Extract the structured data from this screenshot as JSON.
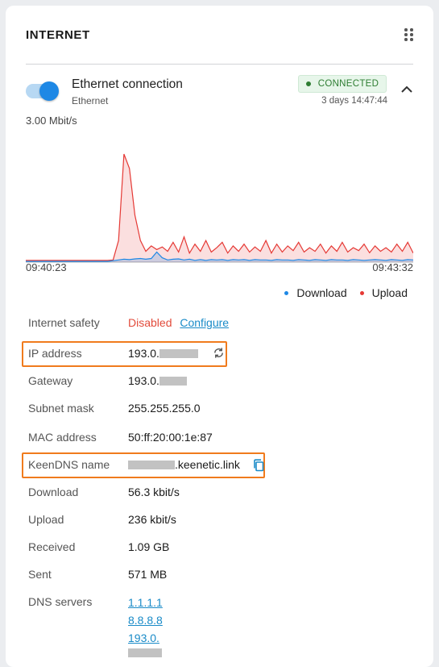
{
  "widget": {
    "title": "INTERNET"
  },
  "connection": {
    "name": "Ethernet connection",
    "subtitle": "Ethernet",
    "enabled": true,
    "status": "CONNECTED",
    "uptime": "3 days 14:47:44",
    "speed_label": "3.00 Mbit/s"
  },
  "chart_data": {
    "type": "area",
    "x_start": "09:40:23",
    "x_end": "09:43:32",
    "ylim": [
      0,
      3.0
    ],
    "y_unit": "Mbit/s",
    "series": [
      {
        "name": "Download",
        "color": "#1e88e5",
        "values": [
          0.02,
          0.02,
          0.02,
          0.02,
          0.02,
          0.02,
          0.02,
          0.02,
          0.02,
          0.02,
          0.02,
          0.02,
          0.02,
          0.02,
          0.02,
          0.02,
          0.04,
          0.06,
          0.08,
          0.07,
          0.09,
          0.1,
          0.08,
          0.1,
          0.28,
          0.12,
          0.06,
          0.08,
          0.09,
          0.06,
          0.08,
          0.05,
          0.07,
          0.05,
          0.07,
          0.06,
          0.07,
          0.05,
          0.07,
          0.06,
          0.07,
          0.05,
          0.07,
          0.06,
          0.06,
          0.05,
          0.07,
          0.06,
          0.06,
          0.05,
          0.07,
          0.06,
          0.05,
          0.07,
          0.06,
          0.05,
          0.07,
          0.06,
          0.06,
          0.05,
          0.07,
          0.06,
          0.05,
          0.06,
          0.07,
          0.06,
          0.05,
          0.07,
          0.06,
          0.05,
          0.07,
          0.06
        ]
      },
      {
        "name": "Upload",
        "color": "#e53935",
        "values": [
          0.05,
          0.05,
          0.05,
          0.05,
          0.05,
          0.05,
          0.05,
          0.05,
          0.05,
          0.05,
          0.05,
          0.05,
          0.05,
          0.05,
          0.05,
          0.05,
          0.06,
          0.6,
          3.0,
          2.6,
          1.3,
          0.6,
          0.3,
          0.45,
          0.35,
          0.42,
          0.3,
          0.55,
          0.28,
          0.7,
          0.25,
          0.5,
          0.3,
          0.6,
          0.28,
          0.4,
          0.55,
          0.25,
          0.45,
          0.3,
          0.5,
          0.28,
          0.42,
          0.3,
          0.6,
          0.25,
          0.5,
          0.28,
          0.45,
          0.32,
          0.55,
          0.28,
          0.4,
          0.3,
          0.5,
          0.25,
          0.45,
          0.3,
          0.55,
          0.28,
          0.4,
          0.32,
          0.5,
          0.26,
          0.45,
          0.3,
          0.4,
          0.28,
          0.5,
          0.3,
          0.55,
          0.25
        ]
      }
    ]
  },
  "legend": {
    "download": "Download",
    "upload": "Upload",
    "download_color": "#1e88e5",
    "upload_color": "#e53935"
  },
  "details": {
    "internet_safety_label": "Internet safety",
    "internet_safety_value": "Disabled",
    "configure_label": "Configure",
    "ip_label": "IP address",
    "ip_value": "193.0.",
    "gateway_label": "Gateway",
    "gateway_value": "193.0.",
    "subnet_label": "Subnet mask",
    "subnet_value": "255.255.255.0",
    "mac_label": "MAC address",
    "mac_value": "50:ff:20:00:1e:87",
    "keendns_label": "KeenDNS name",
    "keendns_value": ".keenetic.link",
    "download_label": "Download",
    "download_value": "56.3 kbit/s",
    "upload_label": "Upload",
    "upload_value": "236 kbit/s",
    "received_label": "Received",
    "received_value": "1.09 GB",
    "sent_label": "Sent",
    "sent_value": "571 MB",
    "dns_label": "DNS servers",
    "dns_servers": [
      "1.1.1.1",
      "8.8.8.8",
      "193.0."
    ]
  },
  "colors": {
    "accent": "#1e88e5",
    "highlight": "#f07b1d",
    "connected": "#2e7d32",
    "disabled": "#e24b3b",
    "link": "#1a8bc8"
  }
}
